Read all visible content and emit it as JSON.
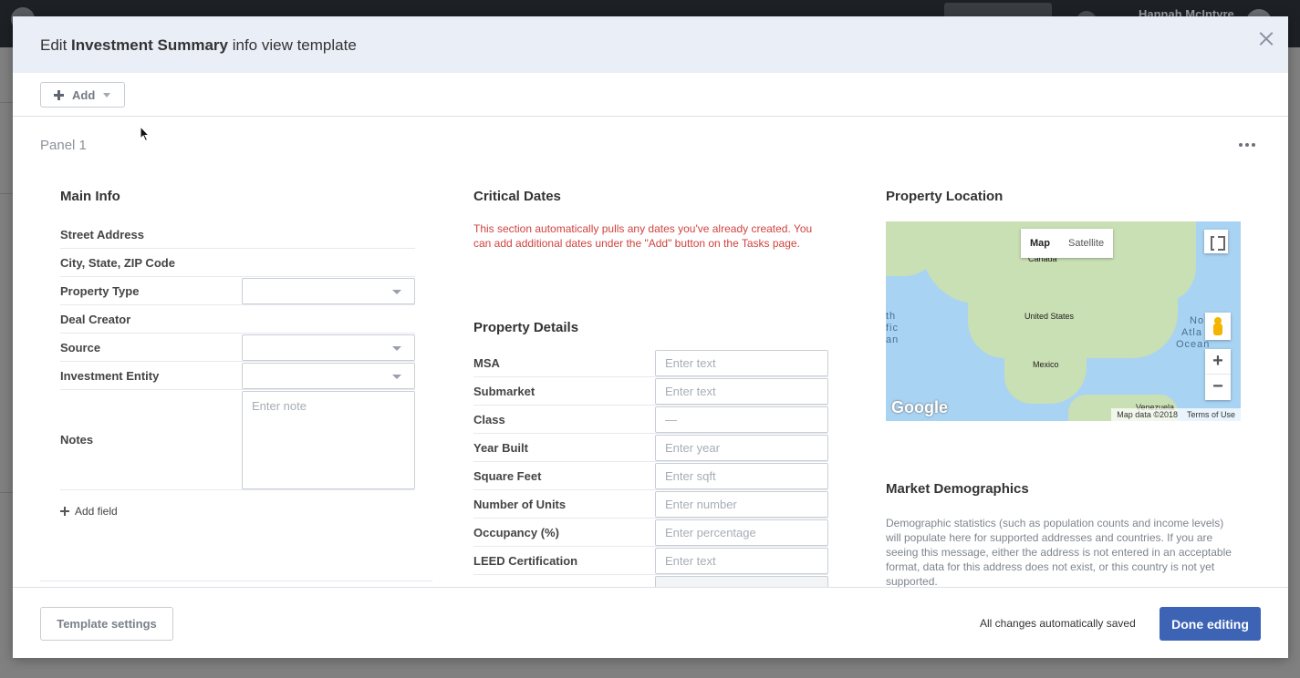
{
  "background": {
    "user_name": "Hannah McIntyre"
  },
  "modal": {
    "title_prefix": "Edit ",
    "title_bold": "Investment Summary",
    "title_suffix": " info view template"
  },
  "toolbar": {
    "add_label": "Add"
  },
  "panel": {
    "title": "Panel 1"
  },
  "main_info": {
    "title": "Main Info",
    "rows": [
      {
        "label": "Street Address"
      },
      {
        "label": "City, State, ZIP Code"
      },
      {
        "label": "Property Type",
        "control": "select",
        "value": ""
      },
      {
        "label": "Deal Creator"
      },
      {
        "label": "Source",
        "control": "select",
        "value": ""
      },
      {
        "label": "Investment Entity",
        "control": "select",
        "value": ""
      },
      {
        "label": "Notes",
        "control": "textarea",
        "placeholder": "Enter note"
      }
    ],
    "add_field_label": "Add field"
  },
  "critical_dates": {
    "title": "Critical Dates",
    "note": "This section automatically pulls any dates you've already created. You can add additional dates under the \"Add\" button on the Tasks page."
  },
  "property_details": {
    "title": "Property Details",
    "rows": [
      {
        "label": "MSA",
        "placeholder": "Enter text"
      },
      {
        "label": "Submarket",
        "placeholder": "Enter text"
      },
      {
        "label": "Class",
        "placeholder": "—"
      },
      {
        "label": "Year Built",
        "placeholder": "Enter year"
      },
      {
        "label": "Square Feet",
        "placeholder": "Enter sqft"
      },
      {
        "label": "Number of Units",
        "placeholder": "Enter number"
      },
      {
        "label": "Occupancy (%)",
        "placeholder": "Enter percentage"
      },
      {
        "label": "LEED Certification",
        "placeholder": "Enter text"
      }
    ]
  },
  "property_location": {
    "title": "Property Location",
    "map": {
      "tab_map": "Map",
      "tab_satellite": "Satellite",
      "labels": {
        "canada": "Canada",
        "united_states": "United States",
        "mexico": "Mexico",
        "venezuela": "Venezuela",
        "pacific_1": "th",
        "pacific_2": "fic",
        "pacific_3": "an",
        "atlantic_1": "No",
        "atlantic_2": "Atla",
        "atlantic_3": "Ocean"
      },
      "logo": "Google",
      "attribution": "Map data ©2018",
      "terms": "Terms of Use",
      "zoom_in": "+",
      "zoom_out": "−"
    }
  },
  "market_demographics": {
    "title": "Market Demographics",
    "text": "Demographic statistics (such as population counts and income levels) will populate here for supported addresses and countries. If you are seeing this message, either the address is not entered in an acceptable format, data for this address does not exist, or this country is not yet supported."
  },
  "footer": {
    "template_settings_label": "Template settings",
    "saved_text": "All changes automatically saved",
    "done_label": "Done editing"
  },
  "colors": {
    "primary": "#3d63b5",
    "warning_text": "#d0433f",
    "header_bg": "#eaeef6"
  }
}
